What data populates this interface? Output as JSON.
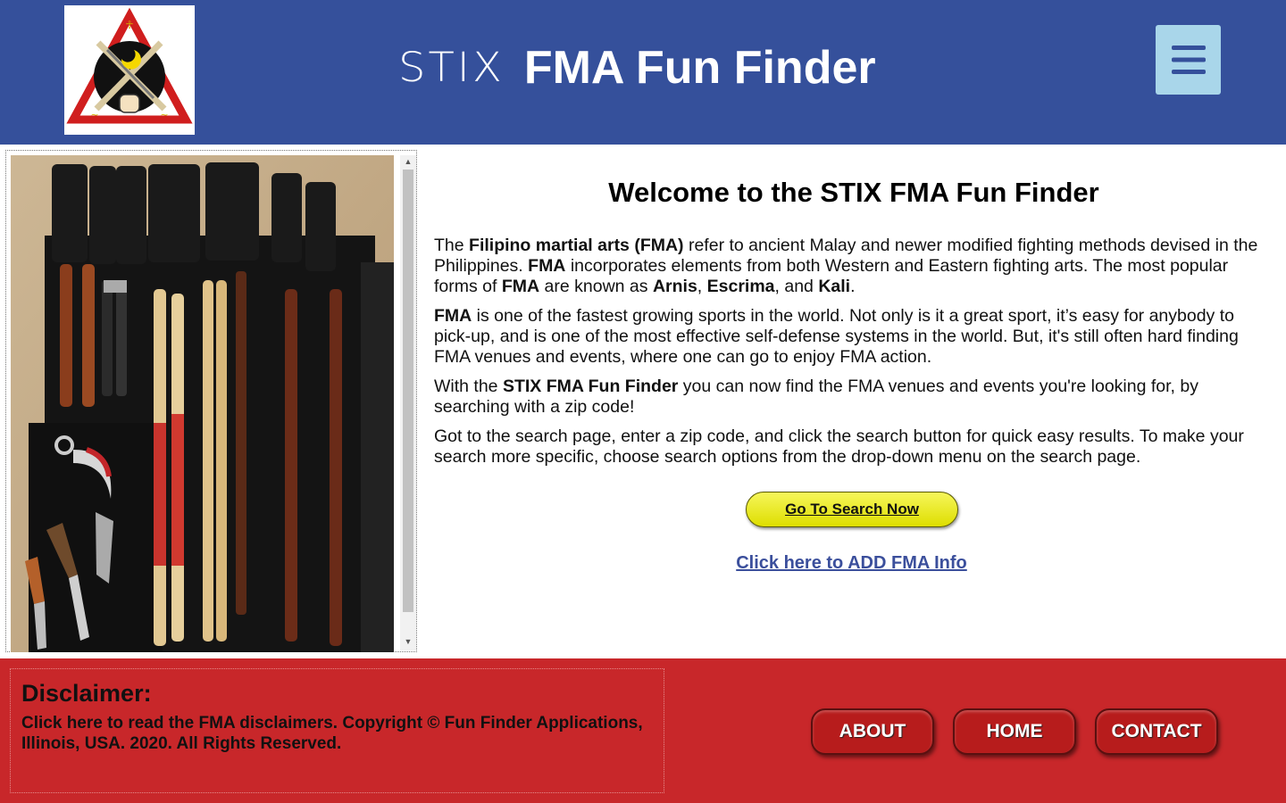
{
  "header": {
    "brand_stix": "STIX",
    "brand_rest": "FMA Fun Finder",
    "logo_alt": "STIX FMA logo"
  },
  "main": {
    "welcome": "Welcome to the STIX FMA Fun Finder",
    "p1": {
      "t1": "The ",
      "b1": "Filipino martial arts (FMA)",
      "t2": " refer to ancient Malay and newer modified fighting methods devised in the Philippines. ",
      "b2": "FMA",
      "t3": " incorporates elements from both Western and Eastern fighting arts. The most popular forms of ",
      "b3": "FMA",
      "t4": " are known as ",
      "b4": "Arnis",
      "t5": ", ",
      "b5": "Escrima",
      "t6": ", and ",
      "b6": "Kali",
      "t7": "."
    },
    "p2": {
      "b1": "FMA",
      "t1": " is one of the fastest growing sports in the world. Not only is it a great sport, it’s easy for anybody to pick-up, and is one of the most effective self-defense systems in the world. But, it's still often hard finding FMA venues and events, where one can go to enjoy FMA action."
    },
    "p3": {
      "t1": "With the ",
      "b1": "STIX FMA Fun Finder",
      "t2": " you can now find the FMA venues and events you're looking for, by searching with a zip code!"
    },
    "p4": "Got to the search page, enter a zip code, and click the search button for quick easy results. To make your search more specific, choose search options from the drop-down menu on the search page.",
    "search_button": "Go To Search Now",
    "add_link": "Click here to ADD FMA Info"
  },
  "footer": {
    "disclaimer_title": "Disclaimer:",
    "disclaimer_text": "Click here to read the FMA disclaimers. Copyright © Fun Finder Applications, Illinois, USA. 2020. All Rights Reserved.",
    "buttons": [
      "ABOUT",
      "HOME",
      "CONTACT"
    ]
  },
  "colors": {
    "header_bg": "#35509b",
    "footer_bg": "#c8272a",
    "menu_button_bg": "#a9d6ea",
    "search_button_bg": "#eeee1a",
    "link": "#3b4f9c"
  },
  "icons": {
    "menu": "hamburger-menu-icon"
  }
}
